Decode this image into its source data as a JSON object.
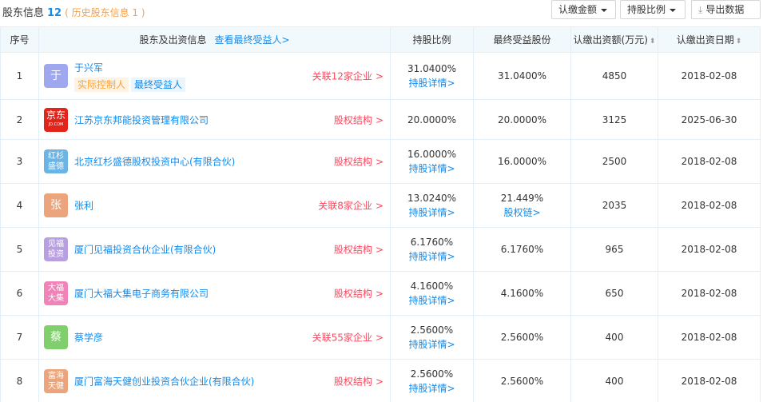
{
  "header": {
    "title": "股东信息",
    "count": "12",
    "history": "( 历史股东信息 1 )",
    "btn_amount": "认缴金额",
    "btn_ratio": "持股比例",
    "btn_export": "导出数据"
  },
  "table": {
    "columns": {
      "index": "序号",
      "holder": "股东及出资信息",
      "holder_link": "查看最终受益人>",
      "ratio": "持股比例",
      "benefit": "最终受益股份",
      "amount": "认缴出资额(万元)",
      "date": "认缴出资日期"
    },
    "rows": [
      {
        "index": "1",
        "logo": "于",
        "logo_color": "#9fa8ef",
        "name": "于兴军",
        "tags": [
          "实际控制人",
          "最终受益人"
        ],
        "right": "关联12家企业",
        "ratio": "31.0400%",
        "ratio_link": "持股详情>",
        "benefit": "31.0400%",
        "benefit_link": "",
        "amount": "4850",
        "date": "2018-02-08"
      },
      {
        "index": "2",
        "logo": "京东",
        "logo_sub": "JD.COM",
        "logo_color": "#e1251b",
        "name": "江苏京东邦能投资管理有限公司",
        "tags": [],
        "right": "股权结构",
        "ratio": "20.0000%",
        "ratio_link": "",
        "benefit": "20.0000%",
        "benefit_link": "",
        "amount": "3125",
        "date": "2025-06-30"
      },
      {
        "index": "3",
        "logo": "红杉盛德",
        "logo_color": "#6bb4e4",
        "name": "北京红杉盛德股权投资中心(有限合伙)",
        "tags": [],
        "right": "股权结构",
        "ratio": "16.0000%",
        "ratio_link": "持股详情>",
        "benefit": "16.0000%",
        "benefit_link": "",
        "amount": "2500",
        "date": "2018-02-08"
      },
      {
        "index": "4",
        "logo": "张",
        "logo_color": "#eba47b",
        "name": "张利",
        "tags": [],
        "right": "关联8家企业",
        "ratio": "13.0240%",
        "ratio_link": "持股详情>",
        "benefit": "21.449%",
        "benefit_link": "股权链>",
        "amount": "2035",
        "date": "2018-02-08"
      },
      {
        "index": "5",
        "logo": "见福投资",
        "logo_color": "#b8a0e0",
        "name": "厦门见福投资合伙企业(有限合伙)",
        "tags": [],
        "right": "股权结构",
        "ratio": "6.1760%",
        "ratio_link": "持股详情>",
        "benefit": "6.1760%",
        "benefit_link": "",
        "amount": "965",
        "date": "2018-02-08"
      },
      {
        "index": "6",
        "logo": "大福大集",
        "logo_color": "#f083b7",
        "name": "厦门大福大集电子商务有限公司",
        "tags": [],
        "right": "股权结构",
        "ratio": "4.1600%",
        "ratio_link": "持股详情>",
        "benefit": "4.1600%",
        "benefit_link": "",
        "amount": "650",
        "date": "2018-02-08"
      },
      {
        "index": "7",
        "logo": "蔡",
        "logo_color": "#7fcf6c",
        "name": "蔡学彦",
        "tags": [],
        "right": "关联55家企业",
        "ratio": "2.5600%",
        "ratio_link": "持股详情>",
        "benefit": "2.5600%",
        "benefit_link": "",
        "amount": "400",
        "date": "2018-02-08"
      },
      {
        "index": "8",
        "logo": "富海天健",
        "logo_color": "#eba47b",
        "name": "厦门富海天健创业投资合伙企业(有限合伙)",
        "tags": [],
        "right": "股权结构",
        "ratio": "2.5600%",
        "ratio_link": "持股详情>",
        "benefit": "2.5600%",
        "benefit_link": "",
        "amount": "400",
        "date": "2018-02-08"
      }
    ]
  }
}
